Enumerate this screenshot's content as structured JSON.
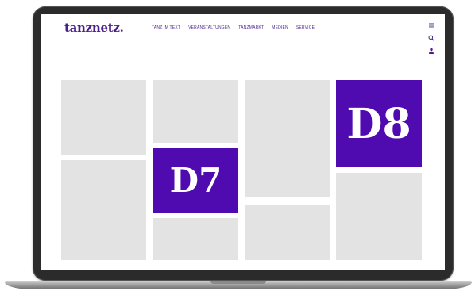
{
  "site": {
    "logo": "tanznetz."
  },
  "nav": {
    "items": [
      {
        "label": "TANZ IM TEXT"
      },
      {
        "label": "VERANSTALTUNGEN"
      },
      {
        "label": "TANZMARKT"
      },
      {
        "label": "MEDIEN"
      },
      {
        "label": "SERVICE"
      }
    ]
  },
  "side_icons": [
    "menu-icon",
    "search-icon",
    "user-icon"
  ],
  "tiles": {
    "d7_label": "D7",
    "d8_label": "D8"
  },
  "colors": {
    "brand_purple": "#4f0ab0",
    "nav_text": "#4a1f8c",
    "placeholder_tile": "#e3e3e3"
  }
}
